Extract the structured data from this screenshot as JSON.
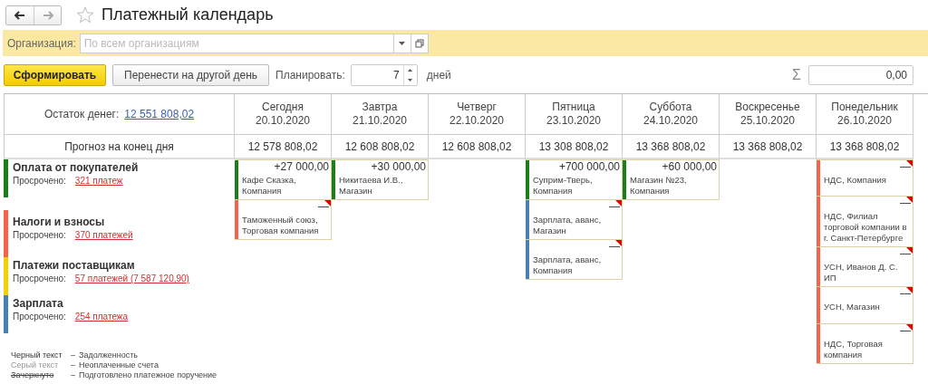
{
  "window": {
    "title": "Платежный календарь"
  },
  "filter": {
    "label": "Организация:",
    "placeholder": "По всем организациям"
  },
  "toolbar": {
    "generate_button": "Сформировать",
    "move_button": "Перенести на другой день",
    "plan_label": "Планировать:",
    "plan_value": "7",
    "plan_unit": "дней",
    "sum_symbol": "Σ",
    "sum_value": "0,00"
  },
  "balance": {
    "label": "Остаток денег:",
    "value": "12 551 808,02"
  },
  "forecast_label": "Прогноз на конец дня",
  "categories": [
    {
      "name": "Оплата от покупателей",
      "overdue_label": "Просрочено:",
      "overdue_link": "321 платеж",
      "color": "#1a7f1a"
    },
    {
      "name": "Налоги и взносы",
      "overdue_label": "Просрочено:",
      "overdue_link": "370 платежей",
      "color": "#f4634a"
    },
    {
      "name": "Платежи поставщикам",
      "overdue_label": "Просрочено:",
      "overdue_link": "57 платежей (7 587 120,90)",
      "color": "#f5d000"
    },
    {
      "name": "Зарплата",
      "overdue_label": "Просрочено:",
      "overdue_link": "254 платежа",
      "color": "#4a7fb5"
    }
  ],
  "columns": [
    {
      "day": "Сегодня",
      "date": "20.10.2020",
      "forecast": "12 578 808,02",
      "cards": [
        {
          "amount": "+27 000,00",
          "text": "Кафе Сказка, Компания",
          "color": "#1a7f1a",
          "flagged": false
        },
        {
          "amount": "—",
          "text": "Таможенный союз, Торговая компания",
          "color": "#f4634a",
          "flagged": true
        }
      ]
    },
    {
      "day": "Завтра",
      "date": "21.10.2020",
      "forecast": "12 608 808,02",
      "cards": [
        {
          "amount": "+30 000,00",
          "text": "Никитаева И.В., Магазин",
          "color": "#1a7f1a",
          "flagged": false
        }
      ]
    },
    {
      "day": "Четверг",
      "date": "22.10.2020",
      "forecast": "12 608 808,02"
    },
    {
      "day": "Пятница",
      "date": "23.10.2020",
      "forecast": "13 308 808,02",
      "cards": [
        {
          "amount": "+700 000,00",
          "text": "Суприм-Тверь, Компания",
          "color": "#1a7f1a",
          "flagged": false
        },
        {
          "amount": "—",
          "text": "Зарплата, аванс, Магазин",
          "color": "#4a7fb5",
          "flagged": true
        },
        {
          "amount": "—",
          "text": "Зарплата, аванс, Компания",
          "color": "#4a7fb5",
          "flagged": true
        }
      ]
    },
    {
      "day": "Суббота",
      "date": "24.10.2020",
      "forecast": "13 368 808,02",
      "cards": [
        {
          "amount": "+60 000,00",
          "text": "Магазин №23, Компания",
          "color": "#1a7f1a",
          "flagged": false
        }
      ]
    },
    {
      "day": "Воскресенье",
      "date": "25.10.2020",
      "forecast": "13 368 808,02"
    },
    {
      "day": "Понедельник",
      "date": "26.10.2020",
      "forecast": "13 368 808,02",
      "cards": [
        {
          "amount": "—",
          "text": "НДС, Компания",
          "color": "#f4634a",
          "flagged": true
        },
        {
          "amount": "—",
          "text": "НДС, Филиал торговой компании в г. Санкт-Петербурге",
          "color": "#f4634a",
          "flagged": true
        },
        {
          "amount": "—",
          "text": "УСН, Иванов Д. С. ИП",
          "color": "#f4634a",
          "flagged": true
        },
        {
          "amount": "—",
          "text": "УСН, Магазин",
          "color": "#f4634a",
          "flagged": true
        },
        {
          "amount": "—",
          "text": "НДС, Торговая компания",
          "color": "#f4634a",
          "flagged": true
        }
      ]
    }
  ],
  "legend": [
    {
      "kind": "plain",
      "sample": "Черный текст",
      "separator": "–",
      "description": "Задолженность"
    },
    {
      "kind": "muted",
      "sample": "Серый текст",
      "separator": "–",
      "description": "Неоплаченные счета"
    },
    {
      "kind": "struck",
      "sample": "Зачеркнуто",
      "separator": "–",
      "description": "Подготовлено платежное поручение"
    }
  ]
}
